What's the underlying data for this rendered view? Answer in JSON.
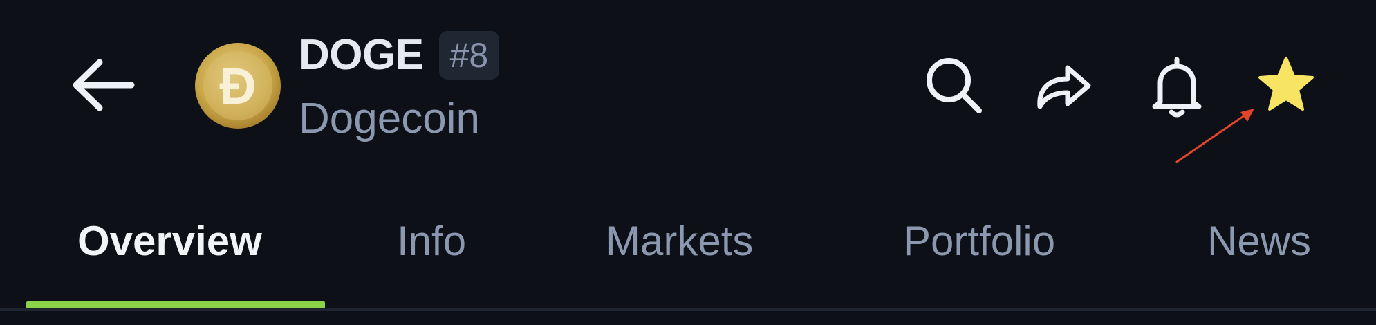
{
  "header": {
    "symbol": "DOGE",
    "rank": "#8",
    "name": "Dogecoin",
    "logo_letter": "Ð"
  },
  "actions": {
    "icons": [
      "search-icon",
      "share-icon",
      "bell-icon",
      "star-icon"
    ],
    "favorite": true
  },
  "tabs": [
    {
      "label": "Overview",
      "active": true
    },
    {
      "label": "Info",
      "active": false
    },
    {
      "label": "Markets",
      "active": false
    },
    {
      "label": "Portfolio",
      "active": false
    },
    {
      "label": "News",
      "active": false
    }
  ],
  "colors": {
    "background": "#0d1117",
    "active_tab_indicator": "#8bd448",
    "star": "#f7e463",
    "muted_text": "#8c98b0",
    "annotation_arrow": "#e0452b"
  }
}
